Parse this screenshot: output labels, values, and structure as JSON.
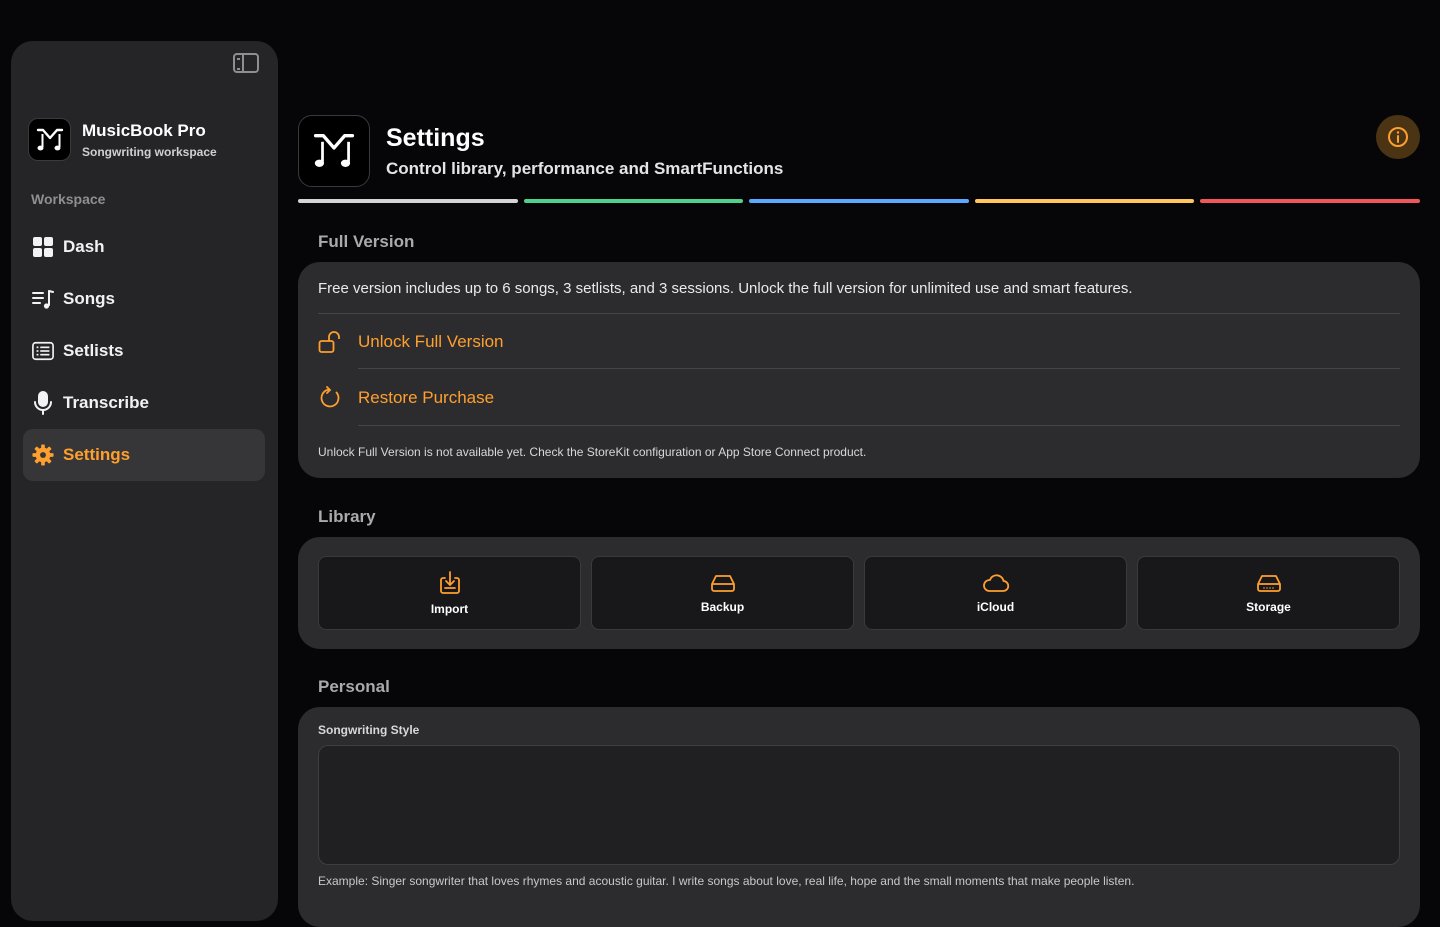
{
  "app": {
    "name": "MusicBook Pro",
    "subtitle": "Songwriting workspace"
  },
  "sidebar": {
    "section_label": "Workspace",
    "items": [
      {
        "label": "Dash",
        "icon": "grid-icon",
        "active": false
      },
      {
        "label": "Songs",
        "icon": "music-list-icon",
        "active": false
      },
      {
        "label": "Setlists",
        "icon": "list-icon",
        "active": false
      },
      {
        "label": "Transcribe",
        "icon": "microphone-icon",
        "active": false
      },
      {
        "label": "Settings",
        "icon": "gear-icon",
        "active": true
      }
    ]
  },
  "header": {
    "title": "Settings",
    "subtitle": "Control library, performance and SmartFunctions"
  },
  "progress_colors": [
    "#d4d4d6",
    "#4fd18b",
    "#5aa8ff",
    "#ffc65c",
    "#f2565a"
  ],
  "full_version": {
    "title": "Full Version",
    "description": "Free version includes up to 6 songs, 3 setlists, and 3 sessions. Unlock the full version for unlimited use and smart features.",
    "unlock_label": "Unlock Full Version",
    "restore_label": "Restore Purchase",
    "note": "Unlock Full Version is not available yet. Check the StoreKit configuration or App Store Connect product."
  },
  "library": {
    "title": "Library",
    "tiles": [
      {
        "label": "Import",
        "icon": "import-icon"
      },
      {
        "label": "Backup",
        "icon": "drive-icon"
      },
      {
        "label": "iCloud",
        "icon": "cloud-icon"
      },
      {
        "label": "Storage",
        "icon": "storage-icon"
      }
    ]
  },
  "personal": {
    "title": "Personal",
    "field_label": "Songwriting Style",
    "field_value": "",
    "hint": "Example: Singer songwriter that loves rhymes and acoustic guitar. I write songs about love, real life, hope and the small moments that make people listen."
  },
  "colors": {
    "accent": "#ff9f2e",
    "background": "#060608",
    "card": "#2c2c2e",
    "sidebar": "#252527"
  }
}
